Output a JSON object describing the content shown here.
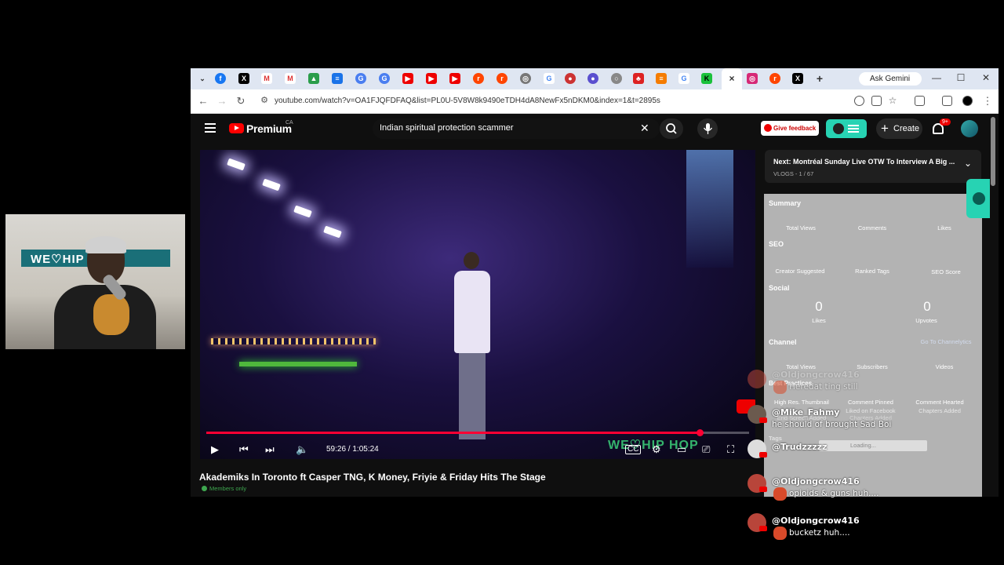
{
  "browser": {
    "gemini_label": "Ask Gemini",
    "url": "youtube.com/watch?v=OA1FJQFDFAQ&list=PL0U-5V8W8k9490eTDH4dA8NewFx5nDKM0&index=1&t=2895s",
    "active_tab_close": "×"
  },
  "youtube": {
    "logo_text": "Premium",
    "region": "CA",
    "search_value": "Indian spiritual protection scammer",
    "feedback_label": "Give feedback",
    "create_label": "Create",
    "notif_badge": "9+"
  },
  "player": {
    "time": "59:26 / 1:05:24",
    "progress": 0.909,
    "watermark": "WE♡HIP HOP",
    "title": "Akademiks In Toronto ft Casper TNG, K Money, Friyie & Friday Hits The Stage",
    "members_badge": "Members only"
  },
  "playlist": {
    "next_title": "Next: Montréal Sunday Live OTW To Interview A Big ...",
    "next_sub": "VLOGS - 1 / 67"
  },
  "vidiq": {
    "summary": "Summary",
    "summary_cols": [
      "Total Views",
      "Comments",
      "Likes"
    ],
    "seo": "SEO",
    "seo_cols": [
      "Creator Suggested",
      "Ranked Tags",
      "SEO Score"
    ],
    "social": "Social",
    "likes_value": "0",
    "likes_label": "Likes",
    "upvotes_value": "0",
    "upvotes_label": "Upvotes",
    "channel": "Channel",
    "channel_link": "Go To Channelytics",
    "channel_cols": [
      "Total Views",
      "Subscribers",
      "Videos"
    ],
    "best_practices": "Best Practices",
    "bp_items": [
      "High Res. Thumbnail",
      "Comment Pinned",
      "Comment Hearted",
      "End Screen Added",
      "Liked on Facebook",
      "Chapters Added",
      "Chapters Added"
    ],
    "tags": "Tags",
    "loading": "Loading..."
  },
  "webcam": {
    "banner": "WE♡HIP HOP"
  },
  "chat": [
    {
      "name": "@Oldjongcrow416",
      "text": "Heredat ting still"
    },
    {
      "name": "@Mike_Fahmy",
      "text": "he should of brought Sad Boi"
    },
    {
      "name": "@Trudzzzzz",
      "text": ""
    },
    {
      "name": "@Oldjongcrow416",
      "text": "opioids & guns huh...."
    },
    {
      "name": "@Oldjongcrow416",
      "text": "bucketz huh...."
    }
  ]
}
